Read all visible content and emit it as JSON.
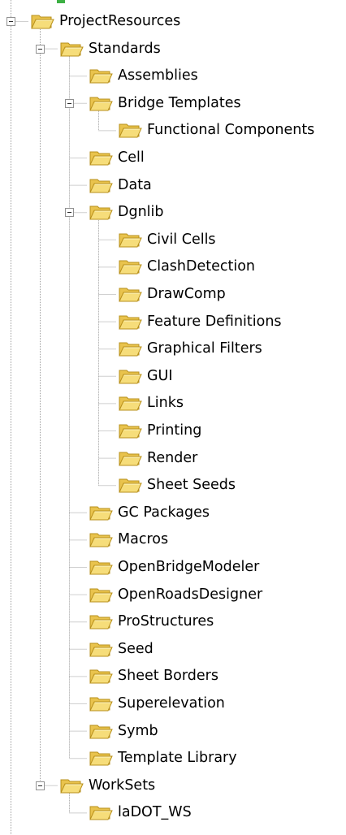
{
  "tree": {
    "root": {
      "label": "ProjectResources",
      "icon": "folder-open-icon",
      "expanded": true,
      "children": [
        {
          "label": "Standards",
          "expanded": true,
          "children": [
            {
              "label": "Assemblies"
            },
            {
              "label": "Bridge Templates",
              "expanded": true,
              "children": [
                {
                  "label": "Functional Components"
                }
              ]
            },
            {
              "label": "Cell"
            },
            {
              "label": "Data"
            },
            {
              "label": "Dgnlib",
              "expanded": true,
              "children": [
                {
                  "label": "Civil Cells"
                },
                {
                  "label": "ClashDetection"
                },
                {
                  "label": "DrawComp"
                },
                {
                  "label": "Feature Definitions"
                },
                {
                  "label": "Graphical Filters"
                },
                {
                  "label": "GUI"
                },
                {
                  "label": "Links"
                },
                {
                  "label": "Printing"
                },
                {
                  "label": "Render"
                },
                {
                  "label": "Sheet Seeds"
                }
              ]
            },
            {
              "label": "GC Packages"
            },
            {
              "label": "Macros"
            },
            {
              "label": "OpenBridgeModeler"
            },
            {
              "label": "OpenRoadsDesigner"
            },
            {
              "label": "ProStructures"
            },
            {
              "label": "Seed"
            },
            {
              "label": "Sheet Borders"
            },
            {
              "label": "Superelevation"
            },
            {
              "label": "Symb"
            },
            {
              "label": "Template Library"
            }
          ]
        },
        {
          "label": "WorkSets",
          "expanded": true,
          "children": [
            {
              "label": "laDOT_WS"
            }
          ]
        }
      ]
    },
    "colors": {
      "folder_body": "#f6dd7a",
      "folder_back": "#e9c34d",
      "folder_edge": "#b8901c",
      "connector": "#a0a0a0",
      "expander_border": "#919191",
      "top_stub_green": "#3cb043"
    }
  }
}
